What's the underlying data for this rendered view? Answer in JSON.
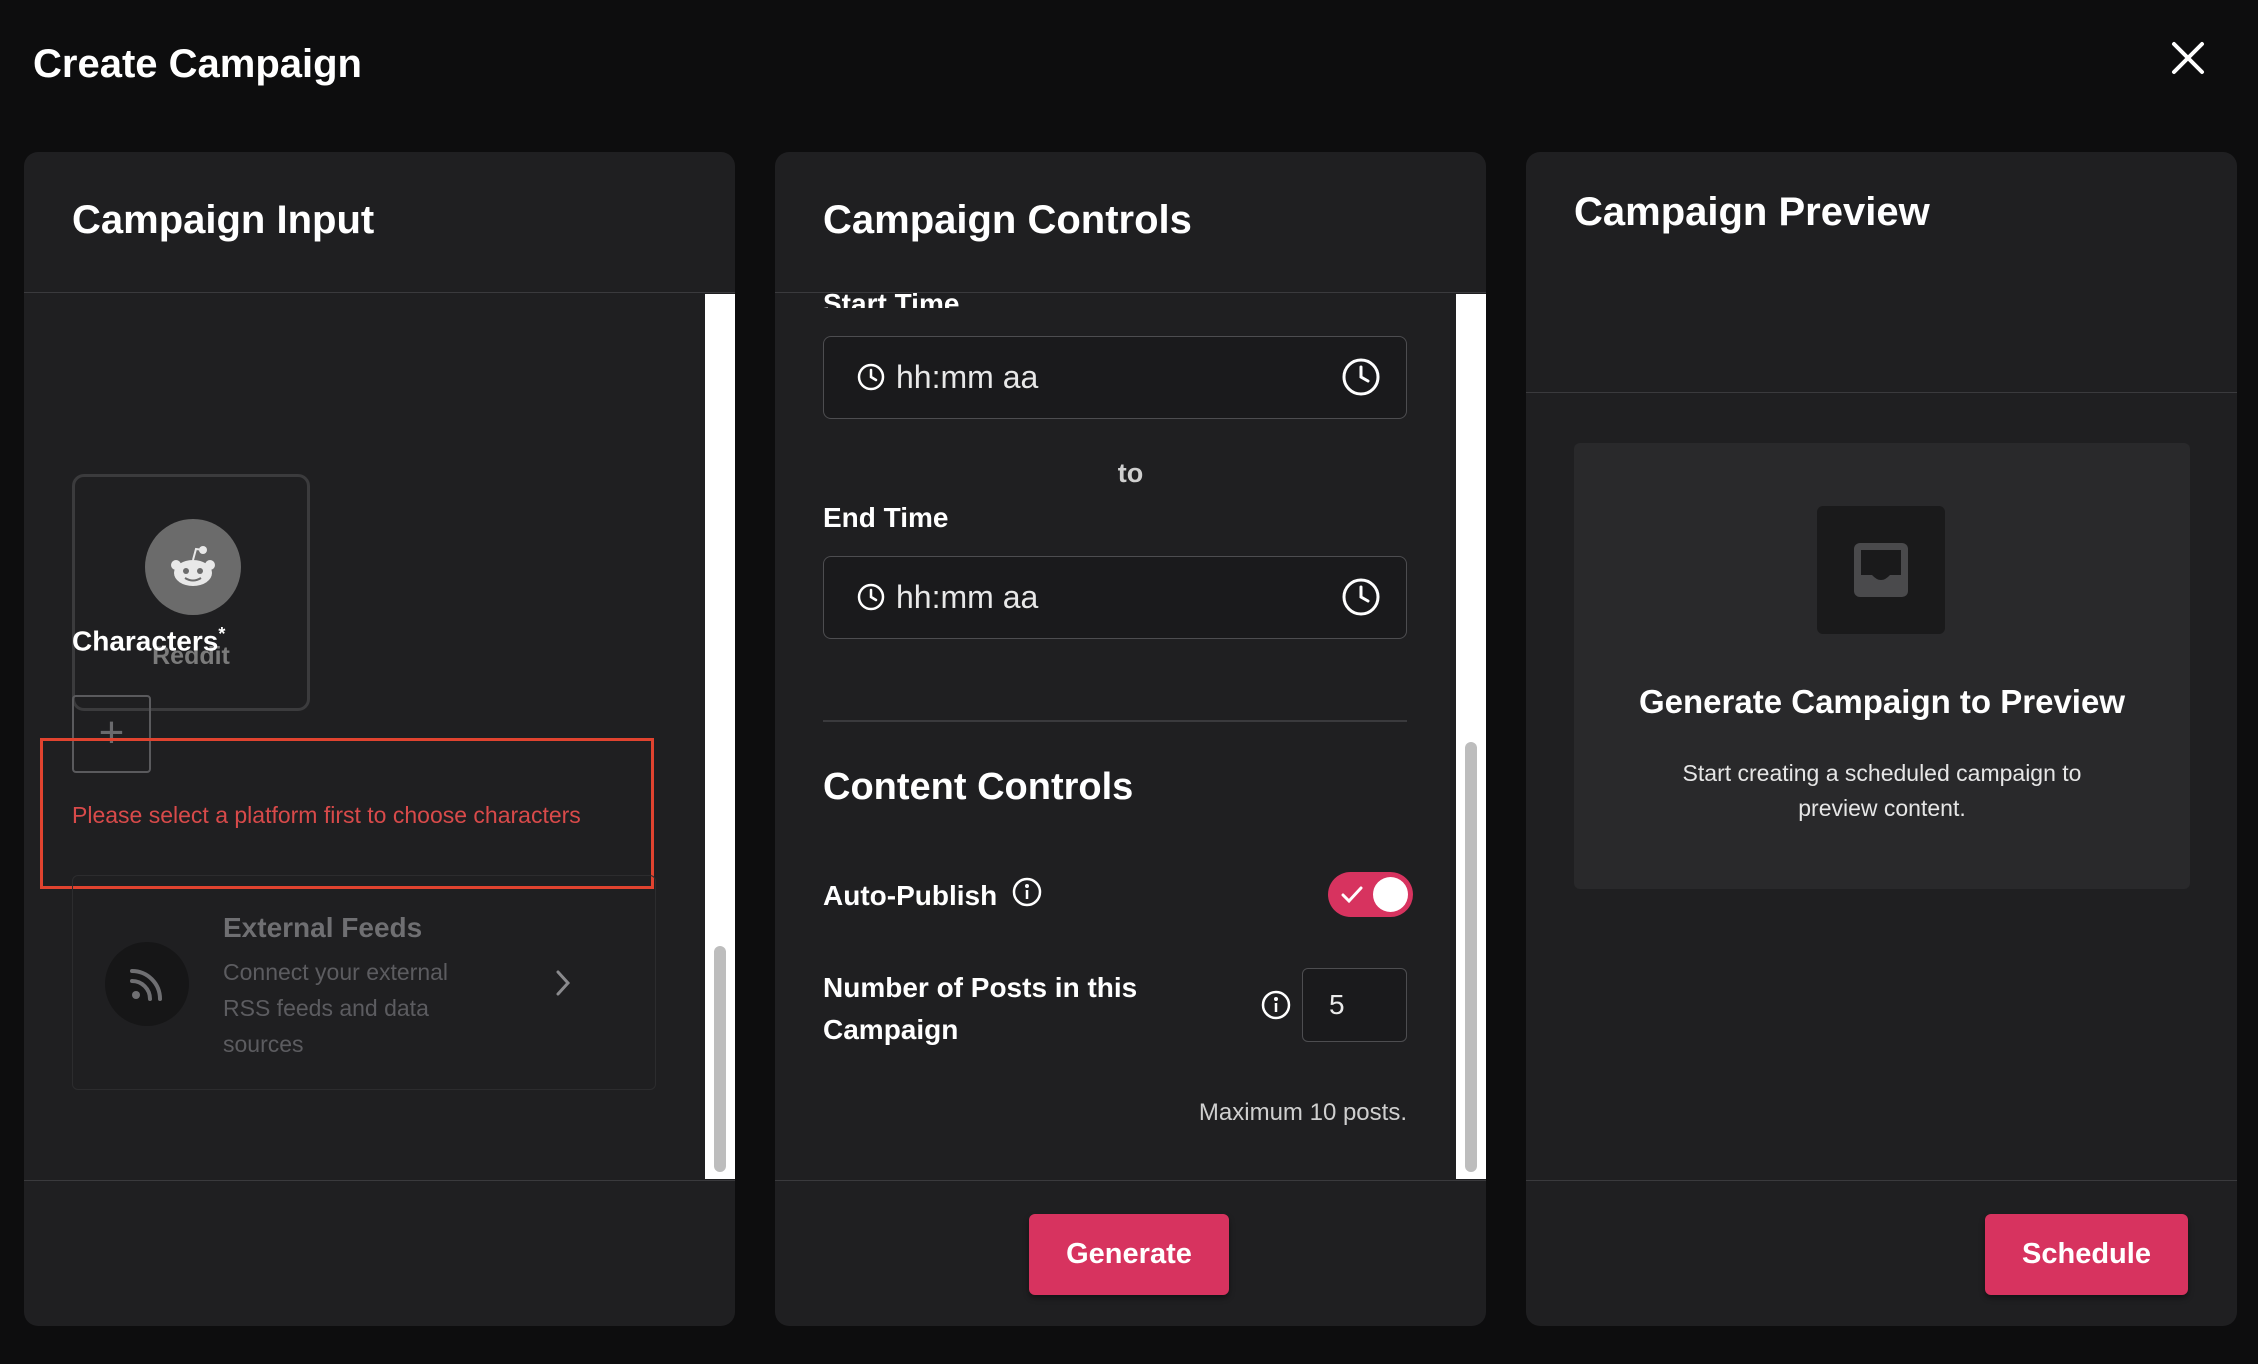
{
  "dialog": {
    "title": "Create Campaign"
  },
  "input_panel": {
    "title": "Campaign Input",
    "platform": {
      "label": "Reddit",
      "icon": "reddit-icon"
    },
    "characters": {
      "label": "Characters",
      "required_mark": "*",
      "add_symbol": "+"
    },
    "error": "Please select a platform first to choose characters",
    "external_feeds": {
      "title": "External Feeds",
      "description": "Connect your external RSS feeds and data sources"
    }
  },
  "controls_panel": {
    "title": "Campaign Controls",
    "start_time": {
      "label": "Start Time",
      "value": "hh:mm aa"
    },
    "to_label": "to",
    "end_time": {
      "label": "End Time",
      "value": "hh:mm aa"
    },
    "content_controls": {
      "title": "Content Controls",
      "auto_publish": {
        "label": "Auto-Publish",
        "enabled": true
      },
      "num_posts": {
        "label": "Number of Posts in this Campaign",
        "value": "5",
        "hint": "Maximum 10 posts."
      }
    },
    "generate_label": "Generate"
  },
  "preview_panel": {
    "title": "Campaign Preview",
    "empty_title": "Generate Campaign to Preview",
    "empty_desc": "Start creating a scheduled campaign to preview content.",
    "schedule_label": "Schedule"
  },
  "colors": {
    "accent": "#d7335f",
    "error": "#d84a4a",
    "highlight_border": "#e0432f"
  }
}
